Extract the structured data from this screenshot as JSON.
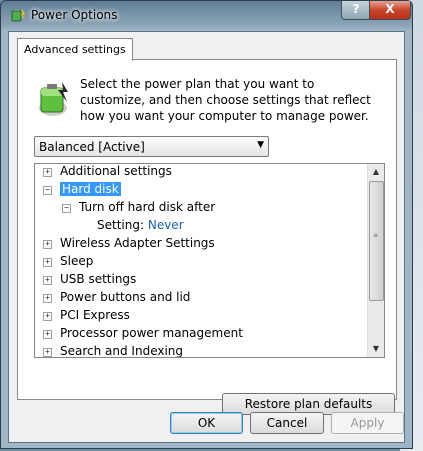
{
  "window": {
    "title": "Power Options",
    "help_glyph": "?",
    "close_glyph": "X"
  },
  "tab": {
    "label": "Advanced settings"
  },
  "intro_text": "Select the power plan that you want to customize, and then choose settings that reflect how you want your computer to manage power.",
  "plan_select": {
    "value": "Balanced [Active]"
  },
  "tree": {
    "items": [
      {
        "label": "Additional settings",
        "state": "collapsed"
      },
      {
        "label": "Hard disk",
        "state": "expanded",
        "selected": true
      },
      {
        "label": "Turn off hard disk after",
        "state": "expanded",
        "level": 1
      },
      {
        "label": "Setting:",
        "value": "Never",
        "level": 2
      },
      {
        "label": "Wireless Adapter Settings",
        "state": "collapsed"
      },
      {
        "label": "Sleep",
        "state": "collapsed"
      },
      {
        "label": "USB settings",
        "state": "collapsed"
      },
      {
        "label": "Power buttons and lid",
        "state": "collapsed"
      },
      {
        "label": "PCI Express",
        "state": "collapsed"
      },
      {
        "label": "Processor power management",
        "state": "collapsed"
      },
      {
        "label": "Search and Indexing",
        "state": "collapsed"
      }
    ]
  },
  "buttons": {
    "restore": "Restore plan defaults",
    "ok": "OK",
    "cancel": "Cancel",
    "apply": "Apply"
  },
  "colors": {
    "selection": "#3399ff",
    "setting_value": "#1a5fb4",
    "close_button": "#c8452a"
  }
}
